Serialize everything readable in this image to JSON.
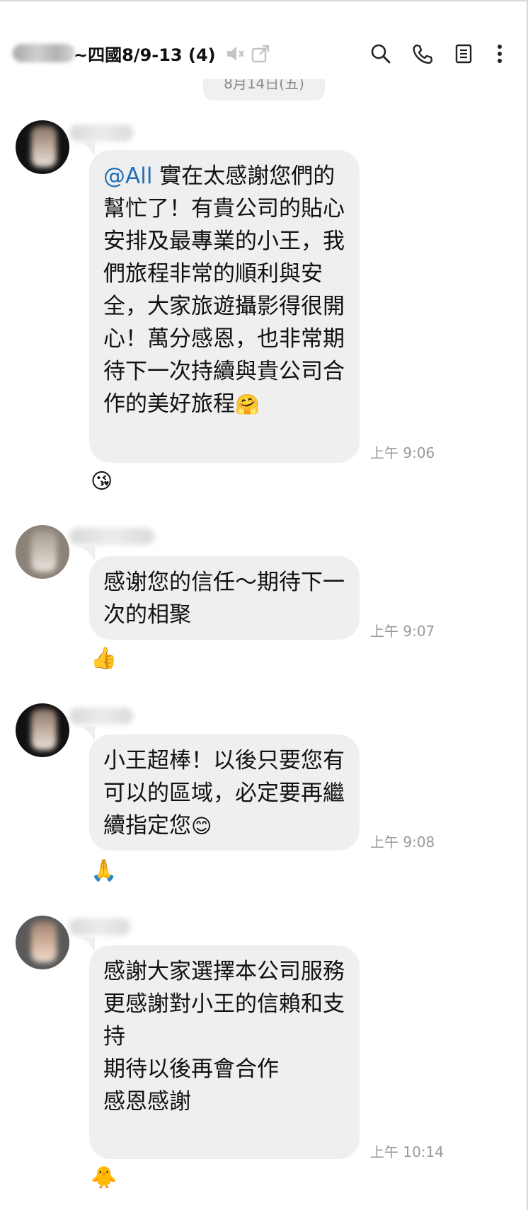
{
  "header": {
    "title": "~四國8/9-13 (4)"
  },
  "date_separator": "8月14日(五)",
  "messages": [
    {
      "mention": "@All",
      "text": " 實在太感謝您們的幫忙了！有貴公司的貼心安排及最專業的小王，我們旅程非常的順利與安全，大家旅遊攝影得很開心！萬分感恩，也非常期待下一次持續與貴公司合作的美好旅程",
      "emoji": "🤗",
      "time": "上午 9:06",
      "reaction": "😘"
    },
    {
      "text": "感谢您的信任～期待下一次的相聚",
      "time": "上午 9:07",
      "reaction": "👍"
    },
    {
      "text": "小王超棒！以後只要您有可以的區域，必定要再繼續指定您",
      "emoji": "😊",
      "time": "上午 9:08",
      "reaction": "🙏"
    },
    {
      "text": "感謝大家選擇本公司服務\n更感謝對小王的信賴和支持\n期待以後再會合作\n感恩感謝",
      "time": "上午 10:14",
      "reaction": "🐥"
    }
  ],
  "colors": {
    "bubble": "#efefef",
    "mention": "#1f6fb8",
    "time": "#9a9a9a"
  },
  "icons": [
    "mute-icon",
    "popout-icon",
    "search-icon",
    "phone-icon",
    "notes-icon",
    "more-icon"
  ]
}
